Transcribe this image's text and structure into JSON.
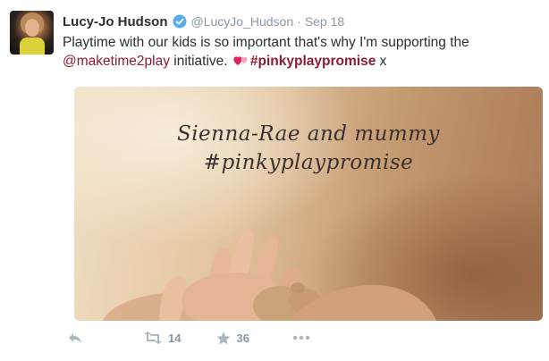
{
  "tweet": {
    "display_name": "Lucy-Jo Hudson",
    "handle": "@LucyJo_Hudson",
    "separator": "·",
    "time": "Sep 18",
    "text": {
      "line1": "Playtime with our kids is so important that's why I'm supporting the",
      "mention": "@maketime2play",
      "middle": " initiative. ",
      "hashtag": "#pinkyplaypromise",
      "end": " x"
    },
    "media": {
      "caption_line1": "Sienna-Rae and mummy",
      "caption_line2": "#pinkyplaypromise"
    },
    "actions": {
      "retweet_count": "14",
      "favorite_count": "36"
    }
  },
  "colors": {
    "link": "#8b1e33",
    "muted": "#8899a6",
    "icon": "#aab8c2",
    "verified": "#55acee"
  },
  "icons": [
    "verified-badge-icon",
    "hearts-emoji-icon",
    "reply-icon",
    "retweet-icon",
    "favorite-star-icon",
    "more-icon"
  ]
}
